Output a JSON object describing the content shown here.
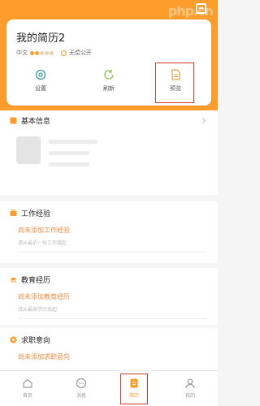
{
  "hero": {
    "logo_text": "php.cn"
  },
  "resume": {
    "title": "我的简历2",
    "language": "中文",
    "completeness_dots": [
      true,
      true,
      false,
      false,
      false
    ],
    "visibility": "无偿公开"
  },
  "actions": [
    {
      "label": "设置",
      "icon": "gear-icon"
    },
    {
      "label": "刷新",
      "icon": "refresh-icon"
    },
    {
      "label": "预览",
      "icon": "document-icon"
    }
  ],
  "sections": {
    "basic": {
      "title": "基本信息"
    },
    "work": {
      "title": "工作经验",
      "add_label": "尚未添加工作经验",
      "hint": "请从最近一份工作填起"
    },
    "edu": {
      "title": "教育经历",
      "add_label": "尚未添加教育经历",
      "hint": "请从最高学历填起"
    },
    "intent": {
      "title": "求职意向",
      "add_label": "尚未添加求职意向"
    }
  },
  "tabbar": [
    {
      "label": "首页",
      "icon": "home-icon"
    },
    {
      "label": "消息",
      "icon": "chat-icon"
    },
    {
      "label": "简历",
      "icon": "resume-icon"
    },
    {
      "label": "我的",
      "icon": "user-icon"
    }
  ],
  "colors": {
    "accent": "#ff9d2c",
    "link": "#f18b3e",
    "highlight_border": "#d33a2e"
  }
}
